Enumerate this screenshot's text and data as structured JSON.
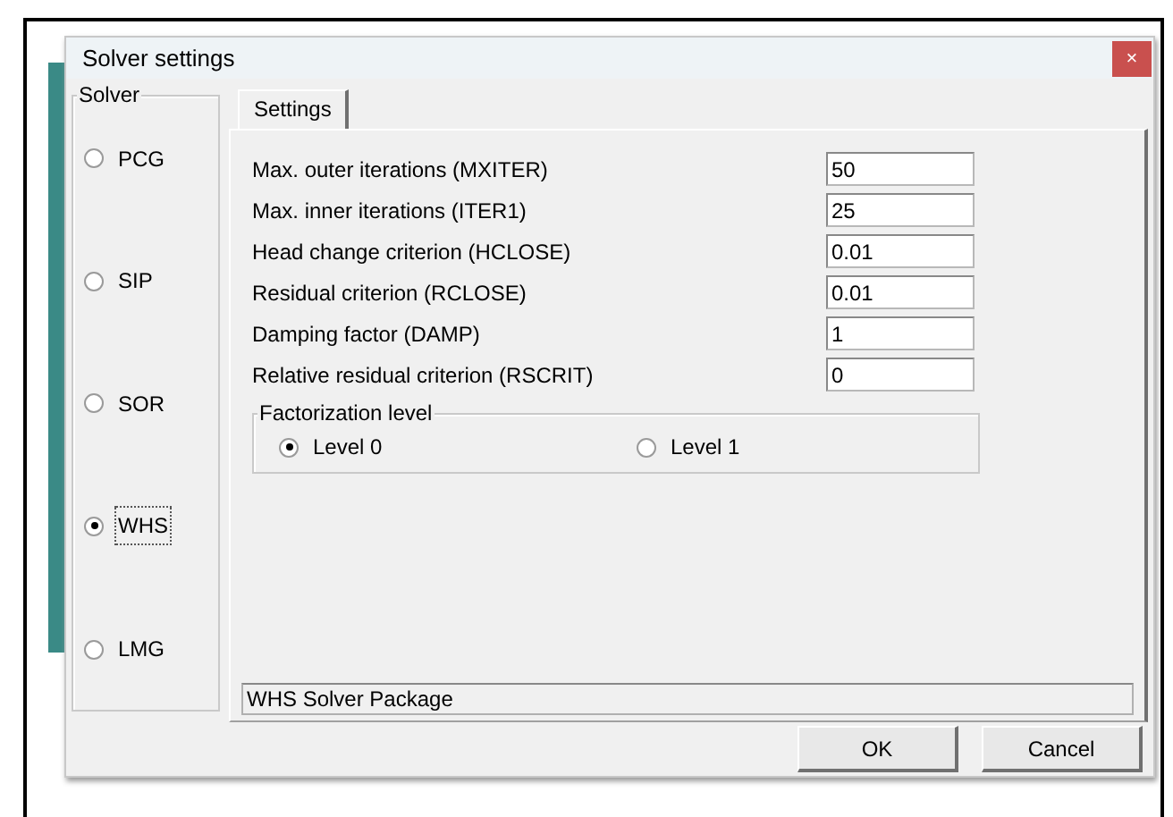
{
  "window": {
    "title": "Solver settings",
    "close": "×"
  },
  "solver_group": {
    "title": "Solver",
    "options": [
      {
        "label": "PCG",
        "selected": false,
        "focused": false
      },
      {
        "label": "SIP",
        "selected": false,
        "focused": false
      },
      {
        "label": "SOR",
        "selected": false,
        "focused": false
      },
      {
        "label": "WHS",
        "selected": true,
        "focused": true
      },
      {
        "label": "LMG",
        "selected": false,
        "focused": false
      }
    ]
  },
  "tabs": [
    {
      "label": "Settings",
      "selected": true
    }
  ],
  "parameters": [
    {
      "label": "Max. outer iterations (MXITER)",
      "value": "50"
    },
    {
      "label": "Max. inner iterations (ITER1)",
      "value": "25"
    },
    {
      "label": "Head change criterion (HCLOSE)",
      "value": "0.01"
    },
    {
      "label": "Residual criterion (RCLOSE)",
      "value": "0.01"
    },
    {
      "label": "Damping factor (DAMP)",
      "value": "1"
    },
    {
      "label": "Relative residual criterion (RSCRIT)",
      "value": "0"
    }
  ],
  "factorization": {
    "title": "Factorization level",
    "options": [
      {
        "label": "Level 0",
        "selected": true
      },
      {
        "label": "Level 1",
        "selected": false
      }
    ]
  },
  "status_bar": "WHS Solver Package",
  "buttons": [
    "OK",
    "Cancel"
  ]
}
